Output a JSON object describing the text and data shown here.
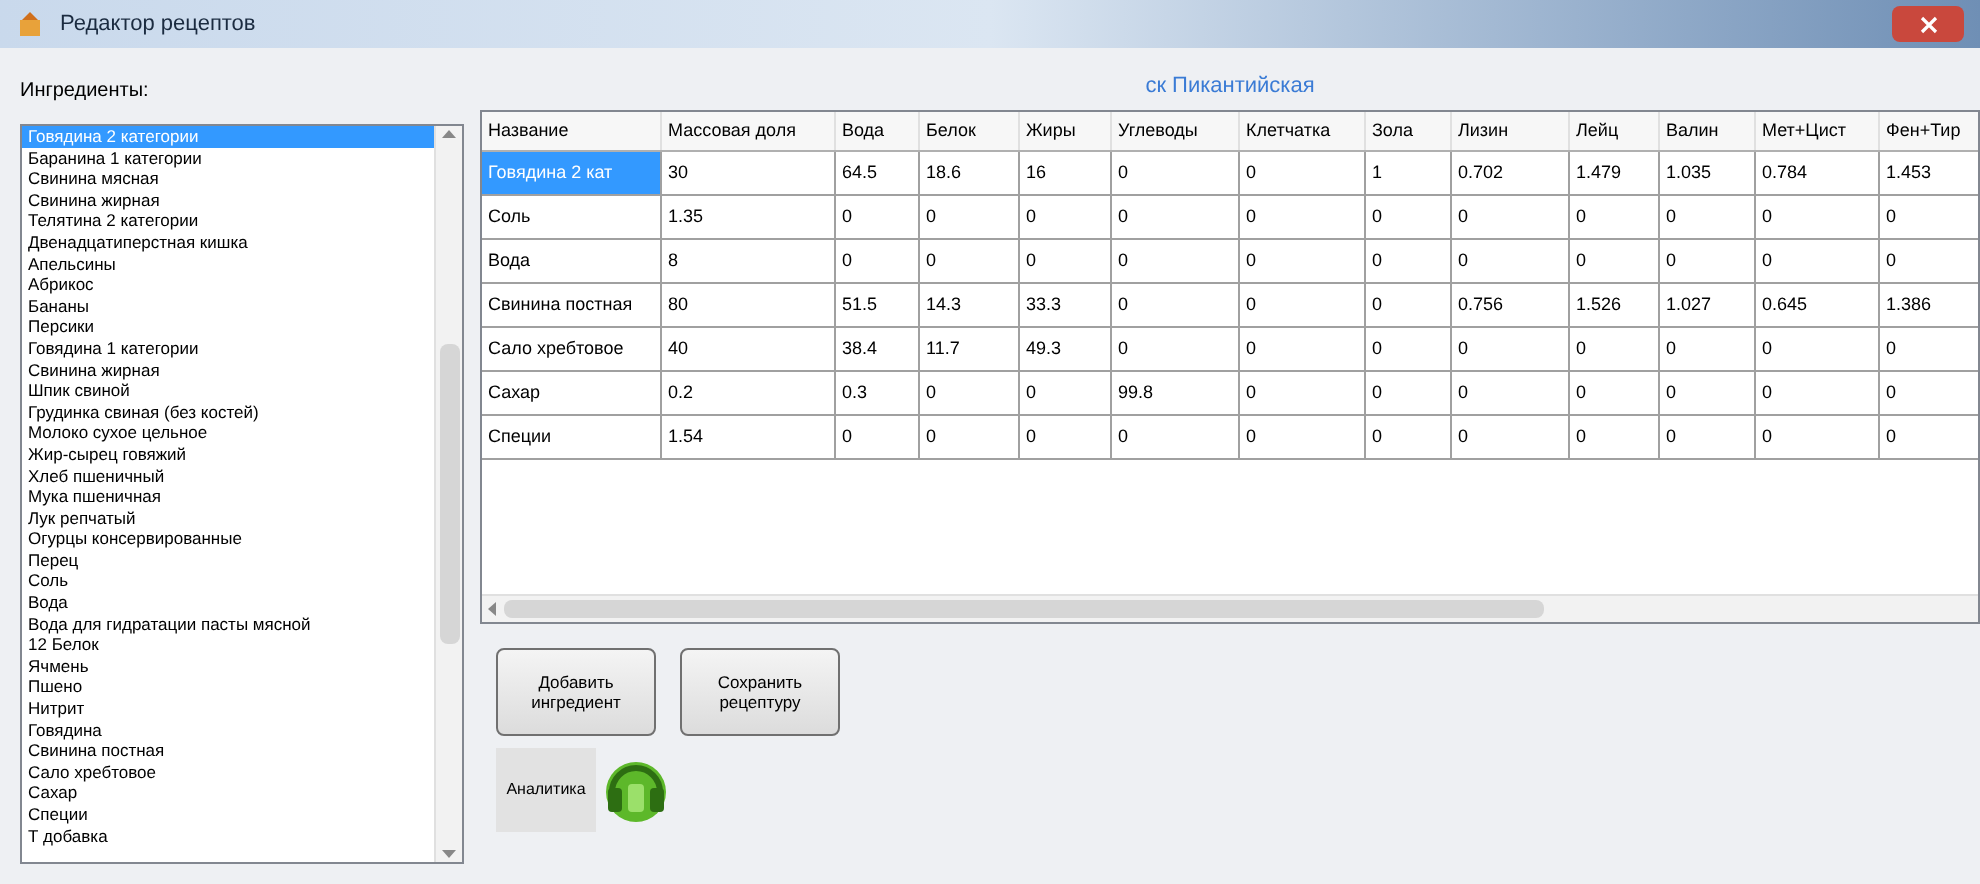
{
  "window": {
    "title": "Редактор рецептов"
  },
  "ingredients": {
    "label": "Ингредиенты:",
    "items": [
      {
        "label": "Говядина 2 категории",
        "selected": true
      },
      {
        "label": "Баранина 1 категории",
        "selected": false
      },
      {
        "label": "Свинина мясная",
        "selected": false
      },
      {
        "label": "Свинина жирная",
        "selected": false
      },
      {
        "label": "Телятина 2 категории",
        "selected": false
      },
      {
        "label": "Двенадцатиперстная кишка",
        "selected": false
      },
      {
        "label": "Апельсины",
        "selected": false
      },
      {
        "label": "Абрикос",
        "selected": false
      },
      {
        "label": "Бананы",
        "selected": false
      },
      {
        "label": "Персики",
        "selected": false
      },
      {
        "label": "Говядина 1 категории",
        "selected": false
      },
      {
        "label": "Свинина жирная",
        "selected": false
      },
      {
        "label": "Шпик свиной",
        "selected": false
      },
      {
        "label": "Грудинка свиная (без костей)",
        "selected": false
      },
      {
        "label": "Молоко сухое цельное",
        "selected": false
      },
      {
        "label": "Жир-сырец говяжий",
        "selected": false
      },
      {
        "label": "Хлеб пшеничный",
        "selected": false
      },
      {
        "label": "Мука пшеничная",
        "selected": false
      },
      {
        "label": "Лук репчатый",
        "selected": false
      },
      {
        "label": "Огурцы консервированные",
        "selected": false
      },
      {
        "label": "Перец",
        "selected": false
      },
      {
        "label": "Соль",
        "selected": false
      },
      {
        "label": "Вода",
        "selected": false
      },
      {
        "label": "Вода для гидратации пасты мясной",
        "selected": false
      },
      {
        "label": "12 Белок",
        "selected": false
      },
      {
        "label": "Ячмень",
        "selected": false
      },
      {
        "label": "Пшено",
        "selected": false
      },
      {
        "label": "Нитрит",
        "selected": false
      },
      {
        "label": "Говядина",
        "selected": false
      },
      {
        "label": "Свинина постная",
        "selected": false
      },
      {
        "label": "Сало хребтовое",
        "selected": false
      },
      {
        "label": "Сахар",
        "selected": false
      },
      {
        "label": "Специи",
        "selected": false
      },
      {
        "label": "Т добавка",
        "selected": false
      }
    ]
  },
  "recipe": {
    "title": "ск Пикантийская",
    "table": {
      "columns": [
        "Название",
        "Массовая доля",
        "Вода",
        "Белок",
        "Жиры",
        "Углеводы",
        "Клетчатка",
        "Зола",
        "Лизин",
        "Лейц",
        "Валин",
        "Мет+Цист",
        "Фен+Тир"
      ],
      "rows": [
        {
          "selected": true,
          "cells": [
            "Говядина 2 кат",
            "30",
            "64.5",
            "18.6",
            "16",
            "0",
            "0",
            "1",
            "0.702",
            "1.479",
            "1.035",
            "0.784",
            "1.453"
          ]
        },
        {
          "selected": false,
          "cells": [
            "Соль",
            "1.35",
            "0",
            "0",
            "0",
            "0",
            "0",
            "0",
            "0",
            "0",
            "0",
            "0",
            "0"
          ]
        },
        {
          "selected": false,
          "cells": [
            "Вода",
            "8",
            "0",
            "0",
            "0",
            "0",
            "0",
            "0",
            "0",
            "0",
            "0",
            "0",
            "0"
          ]
        },
        {
          "selected": false,
          "cells": [
            "Свинина постная",
            "80",
            "51.5",
            "14.3",
            "33.3",
            "0",
            "0",
            "0",
            "0.756",
            "1.526",
            "1.027",
            "0.645",
            "1.386"
          ]
        },
        {
          "selected": false,
          "cells": [
            "Сало хребтовое",
            "40",
            "38.4",
            "11.7",
            "49.3",
            "0",
            "0",
            "0",
            "0",
            "0",
            "0",
            "0",
            "0"
          ]
        },
        {
          "selected": false,
          "cells": [
            "Сахар",
            "0.2",
            "0.3",
            "0",
            "0",
            "99.8",
            "0",
            "0",
            "0",
            "0",
            "0",
            "0",
            "0"
          ]
        },
        {
          "selected": false,
          "cells": [
            "Специи",
            "1.54",
            "0",
            "0",
            "0",
            "0",
            "0",
            "0",
            "0",
            "0",
            "0",
            "0",
            "0"
          ]
        }
      ]
    }
  },
  "buttons": [
    {
      "label": "Добавить ингредиент"
    },
    {
      "label": "Сохранить рецептуру"
    }
  ],
  "analytics_button": {
    "label": "Аналитика"
  }
}
